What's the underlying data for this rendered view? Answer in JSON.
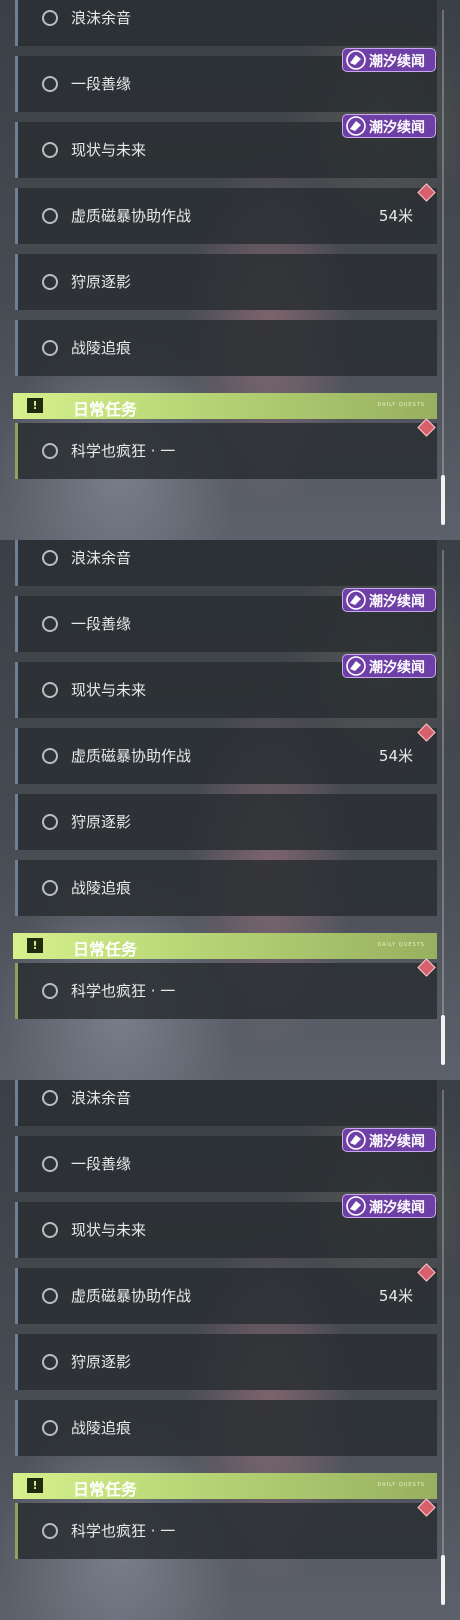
{
  "quests": [
    {
      "label": "浪沫余音"
    },
    {
      "label": "一段善缘"
    },
    {
      "label": "现状与未来"
    },
    {
      "label": "虚质磁暴协助作战",
      "distance": "54米"
    },
    {
      "label": "狩原逐影"
    },
    {
      "label": "战陵追痕"
    }
  ],
  "badge_text": "潮汐续闻",
  "daily_header": {
    "label": "日常任务",
    "tiny": "DAILY QUESTS"
  },
  "daily_quest": {
    "label": "科学也疯狂 · 一"
  },
  "colors": {
    "badge_purple": "#6e3fa6",
    "header_green": "#c8e280",
    "marker_red": "#d8606c",
    "panel_dark": "#2a2e32"
  }
}
